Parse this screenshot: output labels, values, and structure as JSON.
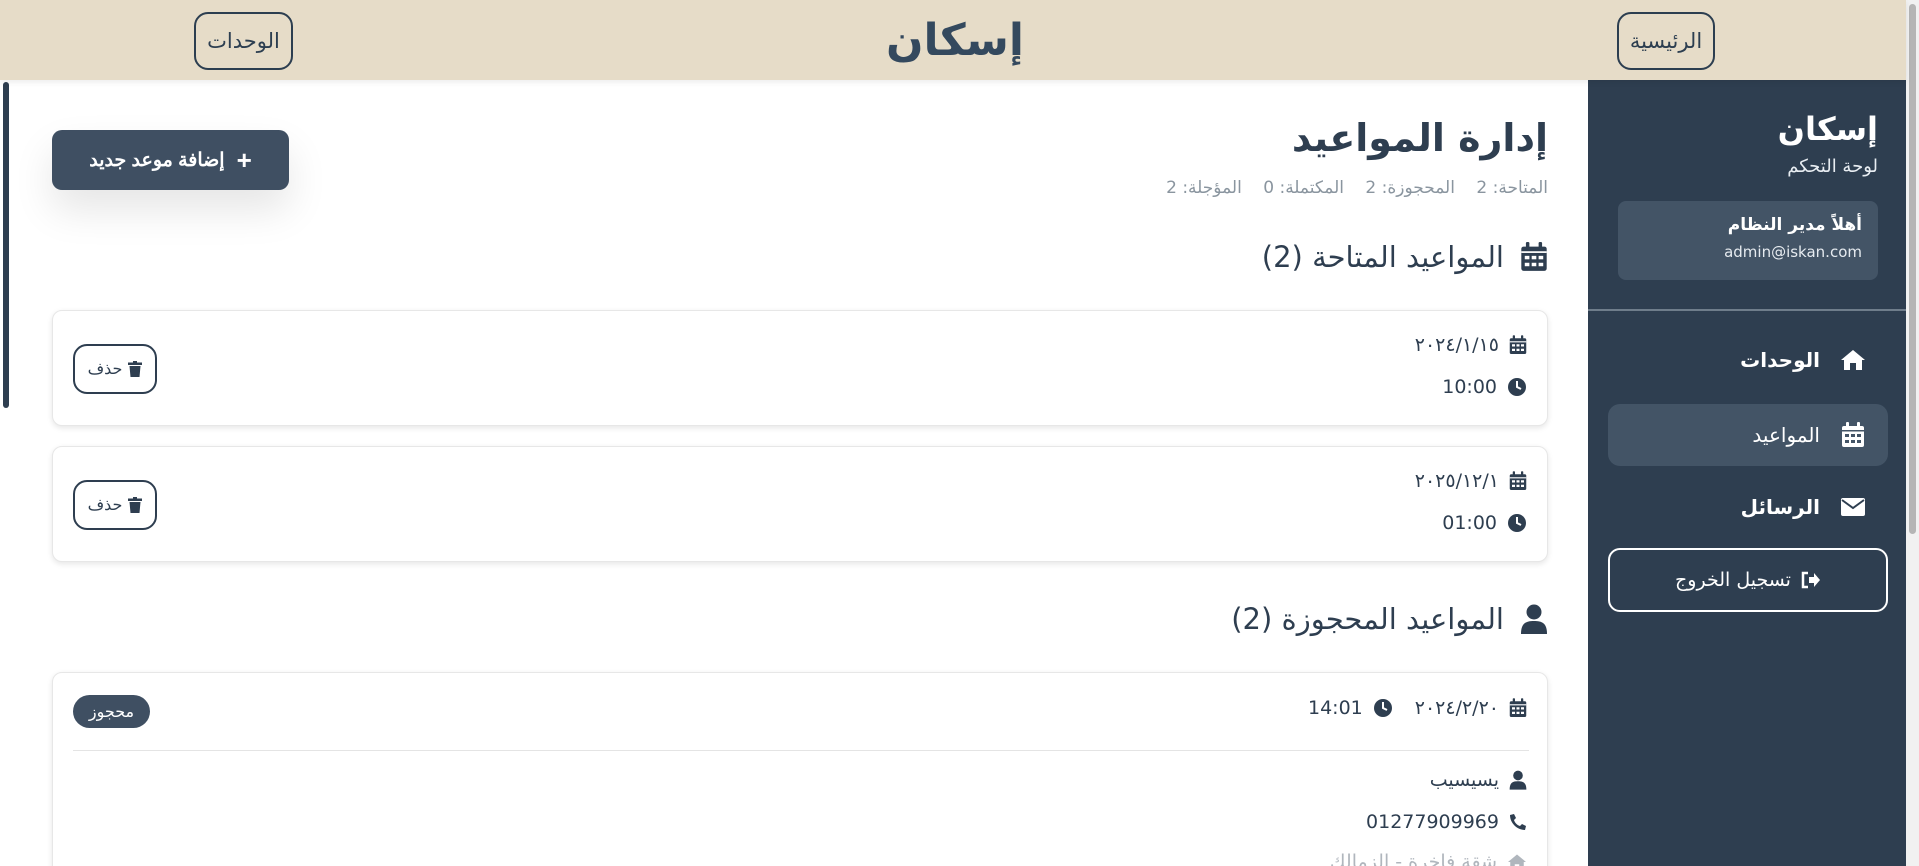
{
  "header": {
    "brand": "إسكان",
    "home_button": "الرئيسية",
    "units_button": "الوحدات"
  },
  "sidebar": {
    "title": "إسكان",
    "subtitle": "لوحة التحكم",
    "user": {
      "greeting": "أهلاً مدير النظام",
      "email": "admin@iskan.com"
    },
    "items": [
      {
        "label": "الوحدات",
        "icon": "home-icon",
        "active": false
      },
      {
        "label": "المواعيد",
        "icon": "calendar-icon",
        "active": true
      },
      {
        "label": "الرسائل",
        "icon": "envelope-icon",
        "active": false
      }
    ],
    "logout_label": "تسجيل الخروج"
  },
  "main": {
    "title": "إدارة المواعيد",
    "add_button": "إضافة موعد جديد",
    "stats": {
      "available": "المتاحة: 2",
      "booked": "المحجوزة: 2",
      "completed": "المكتملة: 0",
      "postponed": "المؤجلة: 2"
    },
    "available_section": {
      "title": "المواعيد المتاحة (2)",
      "items": [
        {
          "date": "٢٠٢٤/١/١٥",
          "time": "10:00",
          "delete_label": "حذف"
        },
        {
          "date": "٢٠٢٥/١٢/١",
          "time": "01:00",
          "delete_label": "حذف"
        }
      ]
    },
    "booked_section": {
      "title": "المواعيد المحجوزة (2)",
      "items": [
        {
          "date": "٢٠٢٤/٢/٢٠",
          "time": "14:01",
          "status": "محجوز",
          "client_name": "يسيسيب",
          "phone": "01277909969",
          "unit": "شقة فاخرة - الزمالك"
        }
      ]
    }
  },
  "colors": {
    "header_bg": "#e6dcc8",
    "sidebar_bg": "#2e3e50",
    "primary": "#3f4f62",
    "text": "#2c3e50",
    "muted": "#8a959f"
  }
}
